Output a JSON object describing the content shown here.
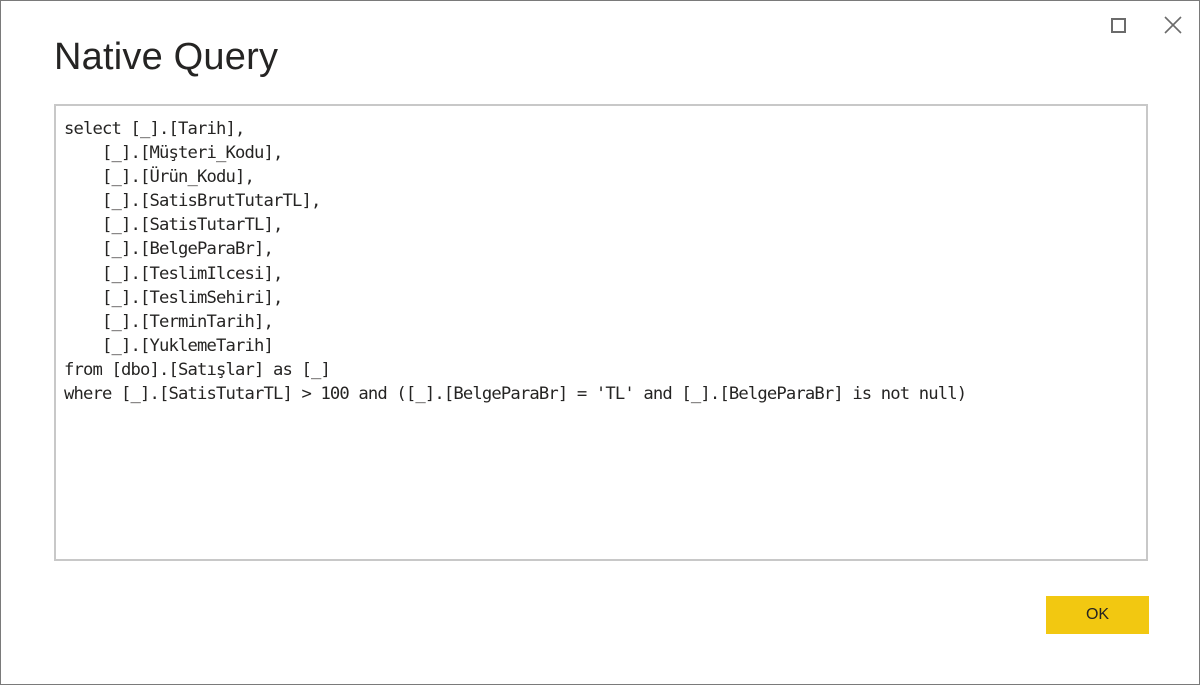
{
  "dialog": {
    "title": "Native Query",
    "window_controls": {
      "maximize_icon": "maximize-icon",
      "close_icon": "close-icon"
    },
    "query_lines": [
      "select [_].[Tarih],",
      "    [_].[Müşteri_Kodu],",
      "    [_].[Ürün_Kodu],",
      "    [_].[SatisBrutTutarTL],",
      "    [_].[SatisTutarTL],",
      "    [_].[BelgeParaBr],",
      "    [_].[TeslimIlcesi],",
      "    [_].[TeslimSehiri],",
      "    [_].[TerminTarih],",
      "    [_].[YuklemeTarih]",
      "from [dbo].[Satışlar] as [_]",
      "where [_].[SatisTutarTL] > 100 and ([_].[BelgeParaBr] = 'TL' and [_].[BelgeParaBr] is not null)"
    ],
    "ok_label": "OK",
    "colors": {
      "ok_button": "#F2C811",
      "border": "#7A7A7A",
      "textbox_border": "#C8C8C8",
      "text": "#252423"
    }
  }
}
